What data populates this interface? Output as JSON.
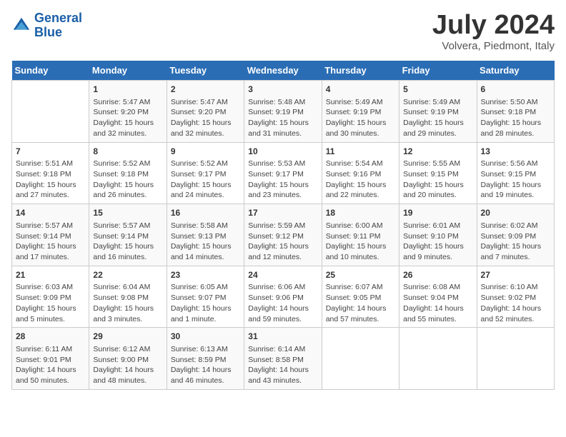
{
  "header": {
    "logo_line1": "General",
    "logo_line2": "Blue",
    "month_year": "July 2024",
    "location": "Volvera, Piedmont, Italy"
  },
  "weekdays": [
    "Sunday",
    "Monday",
    "Tuesday",
    "Wednesday",
    "Thursday",
    "Friday",
    "Saturday"
  ],
  "weeks": [
    [
      {
        "day": "",
        "content": ""
      },
      {
        "day": "1",
        "content": "Sunrise: 5:47 AM\nSunset: 9:20 PM\nDaylight: 15 hours\nand 32 minutes."
      },
      {
        "day": "2",
        "content": "Sunrise: 5:47 AM\nSunset: 9:20 PM\nDaylight: 15 hours\nand 32 minutes."
      },
      {
        "day": "3",
        "content": "Sunrise: 5:48 AM\nSunset: 9:19 PM\nDaylight: 15 hours\nand 31 minutes."
      },
      {
        "day": "4",
        "content": "Sunrise: 5:49 AM\nSunset: 9:19 PM\nDaylight: 15 hours\nand 30 minutes."
      },
      {
        "day": "5",
        "content": "Sunrise: 5:49 AM\nSunset: 9:19 PM\nDaylight: 15 hours\nand 29 minutes."
      },
      {
        "day": "6",
        "content": "Sunrise: 5:50 AM\nSunset: 9:18 PM\nDaylight: 15 hours\nand 28 minutes."
      }
    ],
    [
      {
        "day": "7",
        "content": "Sunrise: 5:51 AM\nSunset: 9:18 PM\nDaylight: 15 hours\nand 27 minutes."
      },
      {
        "day": "8",
        "content": "Sunrise: 5:52 AM\nSunset: 9:18 PM\nDaylight: 15 hours\nand 26 minutes."
      },
      {
        "day": "9",
        "content": "Sunrise: 5:52 AM\nSunset: 9:17 PM\nDaylight: 15 hours\nand 24 minutes."
      },
      {
        "day": "10",
        "content": "Sunrise: 5:53 AM\nSunset: 9:17 PM\nDaylight: 15 hours\nand 23 minutes."
      },
      {
        "day": "11",
        "content": "Sunrise: 5:54 AM\nSunset: 9:16 PM\nDaylight: 15 hours\nand 22 minutes."
      },
      {
        "day": "12",
        "content": "Sunrise: 5:55 AM\nSunset: 9:15 PM\nDaylight: 15 hours\nand 20 minutes."
      },
      {
        "day": "13",
        "content": "Sunrise: 5:56 AM\nSunset: 9:15 PM\nDaylight: 15 hours\nand 19 minutes."
      }
    ],
    [
      {
        "day": "14",
        "content": "Sunrise: 5:57 AM\nSunset: 9:14 PM\nDaylight: 15 hours\nand 17 minutes."
      },
      {
        "day": "15",
        "content": "Sunrise: 5:57 AM\nSunset: 9:14 PM\nDaylight: 15 hours\nand 16 minutes."
      },
      {
        "day": "16",
        "content": "Sunrise: 5:58 AM\nSunset: 9:13 PM\nDaylight: 15 hours\nand 14 minutes."
      },
      {
        "day": "17",
        "content": "Sunrise: 5:59 AM\nSunset: 9:12 PM\nDaylight: 15 hours\nand 12 minutes."
      },
      {
        "day": "18",
        "content": "Sunrise: 6:00 AM\nSunset: 9:11 PM\nDaylight: 15 hours\nand 10 minutes."
      },
      {
        "day": "19",
        "content": "Sunrise: 6:01 AM\nSunset: 9:10 PM\nDaylight: 15 hours\nand 9 minutes."
      },
      {
        "day": "20",
        "content": "Sunrise: 6:02 AM\nSunset: 9:09 PM\nDaylight: 15 hours\nand 7 minutes."
      }
    ],
    [
      {
        "day": "21",
        "content": "Sunrise: 6:03 AM\nSunset: 9:09 PM\nDaylight: 15 hours\nand 5 minutes."
      },
      {
        "day": "22",
        "content": "Sunrise: 6:04 AM\nSunset: 9:08 PM\nDaylight: 15 hours\nand 3 minutes."
      },
      {
        "day": "23",
        "content": "Sunrise: 6:05 AM\nSunset: 9:07 PM\nDaylight: 15 hours\nand 1 minute."
      },
      {
        "day": "24",
        "content": "Sunrise: 6:06 AM\nSunset: 9:06 PM\nDaylight: 14 hours\nand 59 minutes."
      },
      {
        "day": "25",
        "content": "Sunrise: 6:07 AM\nSunset: 9:05 PM\nDaylight: 14 hours\nand 57 minutes."
      },
      {
        "day": "26",
        "content": "Sunrise: 6:08 AM\nSunset: 9:04 PM\nDaylight: 14 hours\nand 55 minutes."
      },
      {
        "day": "27",
        "content": "Sunrise: 6:10 AM\nSunset: 9:02 PM\nDaylight: 14 hours\nand 52 minutes."
      }
    ],
    [
      {
        "day": "28",
        "content": "Sunrise: 6:11 AM\nSunset: 9:01 PM\nDaylight: 14 hours\nand 50 minutes."
      },
      {
        "day": "29",
        "content": "Sunrise: 6:12 AM\nSunset: 9:00 PM\nDaylight: 14 hours\nand 48 minutes."
      },
      {
        "day": "30",
        "content": "Sunrise: 6:13 AM\nSunset: 8:59 PM\nDaylight: 14 hours\nand 46 minutes."
      },
      {
        "day": "31",
        "content": "Sunrise: 6:14 AM\nSunset: 8:58 PM\nDaylight: 14 hours\nand 43 minutes."
      },
      {
        "day": "",
        "content": ""
      },
      {
        "day": "",
        "content": ""
      },
      {
        "day": "",
        "content": ""
      }
    ]
  ]
}
